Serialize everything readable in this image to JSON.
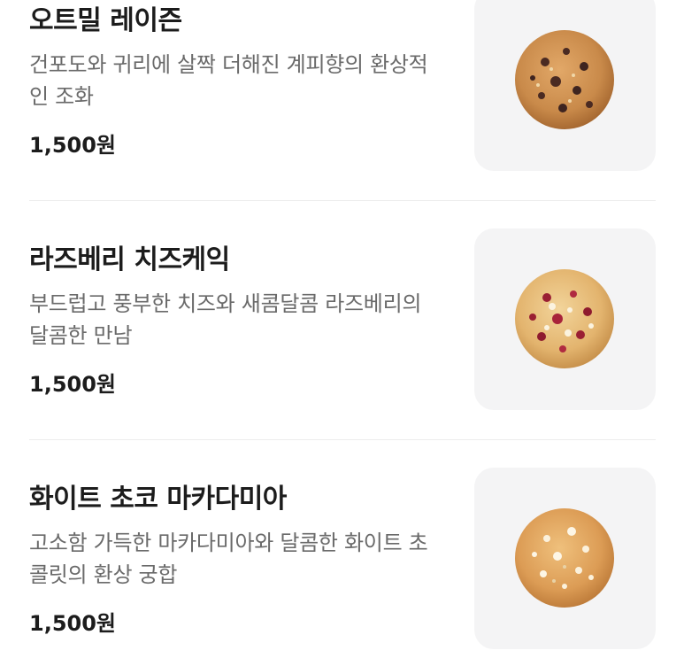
{
  "menu": {
    "items": [
      {
        "title": "오트밀 레이즌",
        "description": "건포도와 귀리에 살짝 더해진 계피향의 환상적인 조화",
        "price": "1,500원",
        "image_icon": "oatmeal-raisin-cookie-icon"
      },
      {
        "title": "라즈베리 치즈케익",
        "description": "부드럽고 풍부한 치즈와 새콤달콤 라즈베리의 달콤한 만남",
        "price": "1,500원",
        "image_icon": "raspberry-cheesecake-cookie-icon"
      },
      {
        "title": "화이트 초코 마카다미아",
        "description": "고소함 가득한 마카다미아와 달콤한 화이트 초콜릿의 환상 궁합",
        "price": "1,500원",
        "image_icon": "white-choco-macadamia-cookie-icon"
      }
    ]
  },
  "colors": {
    "title": "#1c1c1c",
    "description": "#6a6a6a",
    "thumbnail_bg": "#f4f4f5",
    "divider": "#ececec"
  }
}
